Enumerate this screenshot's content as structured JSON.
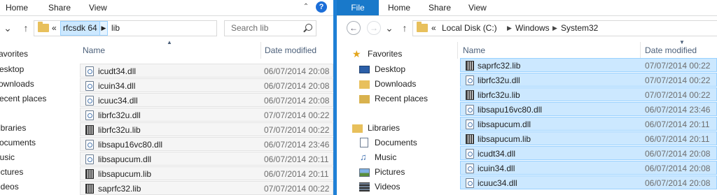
{
  "left_window": {
    "ribbon": {
      "tabs": [
        "Home",
        "Share",
        "View"
      ]
    },
    "address": {
      "overflow": "«",
      "crumbs": [
        "rfcsdk 64",
        "lib"
      ]
    },
    "search_placeholder": "Search lib",
    "nav_items": [
      {
        "label": "avorites",
        "icon": "star-icon"
      },
      {
        "label": "esktop",
        "icon": "desktop-icon"
      },
      {
        "label": "ownloads",
        "icon": "downloads-icon"
      },
      {
        "label": "ecent places",
        "icon": "recent-places-icon"
      },
      {
        "label": "",
        "icon": ""
      },
      {
        "label": "ibraries",
        "icon": "libraries-icon"
      },
      {
        "label": "ocuments",
        "icon": "documents-icon"
      },
      {
        "label": "lusic",
        "icon": "music-icon"
      },
      {
        "label": "ictures",
        "icon": "pictures-icon"
      },
      {
        "label": "ideos",
        "icon": "videos-icon"
      }
    ],
    "columns": {
      "name": "Name",
      "date": "Date modified"
    },
    "files": [
      {
        "name": "icudt34.dll",
        "date": "06/07/2014 20:08",
        "type": "dll"
      },
      {
        "name": "icuin34.dll",
        "date": "06/07/2014 20:08",
        "type": "dll"
      },
      {
        "name": "icuuc34.dll",
        "date": "06/07/2014 20:08",
        "type": "dll"
      },
      {
        "name": "librfc32u.dll",
        "date": "07/07/2014 00:22",
        "type": "dll"
      },
      {
        "name": "librfc32u.lib",
        "date": "07/07/2014 00:22",
        "type": "lib"
      },
      {
        "name": "libsapu16vc80.dll",
        "date": "06/07/2014 23:46",
        "type": "dll"
      },
      {
        "name": "libsapucum.dll",
        "date": "06/07/2014 20:11",
        "type": "dll"
      },
      {
        "name": "libsapucum.lib",
        "date": "06/07/2014 20:11",
        "type": "lib"
      },
      {
        "name": "saprfc32.lib",
        "date": "07/07/2014 00:22",
        "type": "lib"
      }
    ]
  },
  "right_window": {
    "ribbon": {
      "file_tab": "File",
      "tabs": [
        "Home",
        "Share",
        "View"
      ]
    },
    "address": {
      "overflow": "«",
      "crumbs": [
        "Local Disk (C:)",
        "Windows",
        "System32"
      ]
    },
    "nav_items": [
      {
        "label": "Favorites",
        "icon": "star-icon"
      },
      {
        "label": "Desktop",
        "icon": "desktop-icon"
      },
      {
        "label": "Downloads",
        "icon": "downloads-icon"
      },
      {
        "label": "Recent places",
        "icon": "recent-places-icon"
      },
      {
        "label": "",
        "icon": ""
      },
      {
        "label": "Libraries",
        "icon": "libraries-icon"
      },
      {
        "label": "Documents",
        "icon": "documents-icon"
      },
      {
        "label": "Music",
        "icon": "music-icon"
      },
      {
        "label": "Pictures",
        "icon": "pictures-icon"
      },
      {
        "label": "Videos",
        "icon": "videos-icon"
      }
    ],
    "columns": {
      "name": "Name",
      "date": "Date modified"
    },
    "files": [
      {
        "name": "saprfc32.lib",
        "date": "07/07/2014 00:22",
        "type": "lib"
      },
      {
        "name": "librfc32u.dll",
        "date": "07/07/2014 00:22",
        "type": "dll"
      },
      {
        "name": "librfc32u.lib",
        "date": "07/07/2014 00:22",
        "type": "lib"
      },
      {
        "name": "libsapu16vc80.dll",
        "date": "06/07/2014 23:46",
        "type": "dll"
      },
      {
        "name": "libsapucum.dll",
        "date": "06/07/2014 20:11",
        "type": "dll"
      },
      {
        "name": "libsapucum.lib",
        "date": "06/07/2014 20:11",
        "type": "lib"
      },
      {
        "name": "icudt34.dll",
        "date": "06/07/2014 20:08",
        "type": "dll"
      },
      {
        "name": "icuin34.dll",
        "date": "06/07/2014 20:08",
        "type": "dll"
      },
      {
        "name": "icuuc34.dll",
        "date": "06/07/2014 20:08",
        "type": "dll"
      }
    ]
  },
  "colors": {
    "selection": "#cce8ff",
    "selection_border": "#99d1ff",
    "file_tab": "#1979ca",
    "divider": "#1f80d6"
  }
}
